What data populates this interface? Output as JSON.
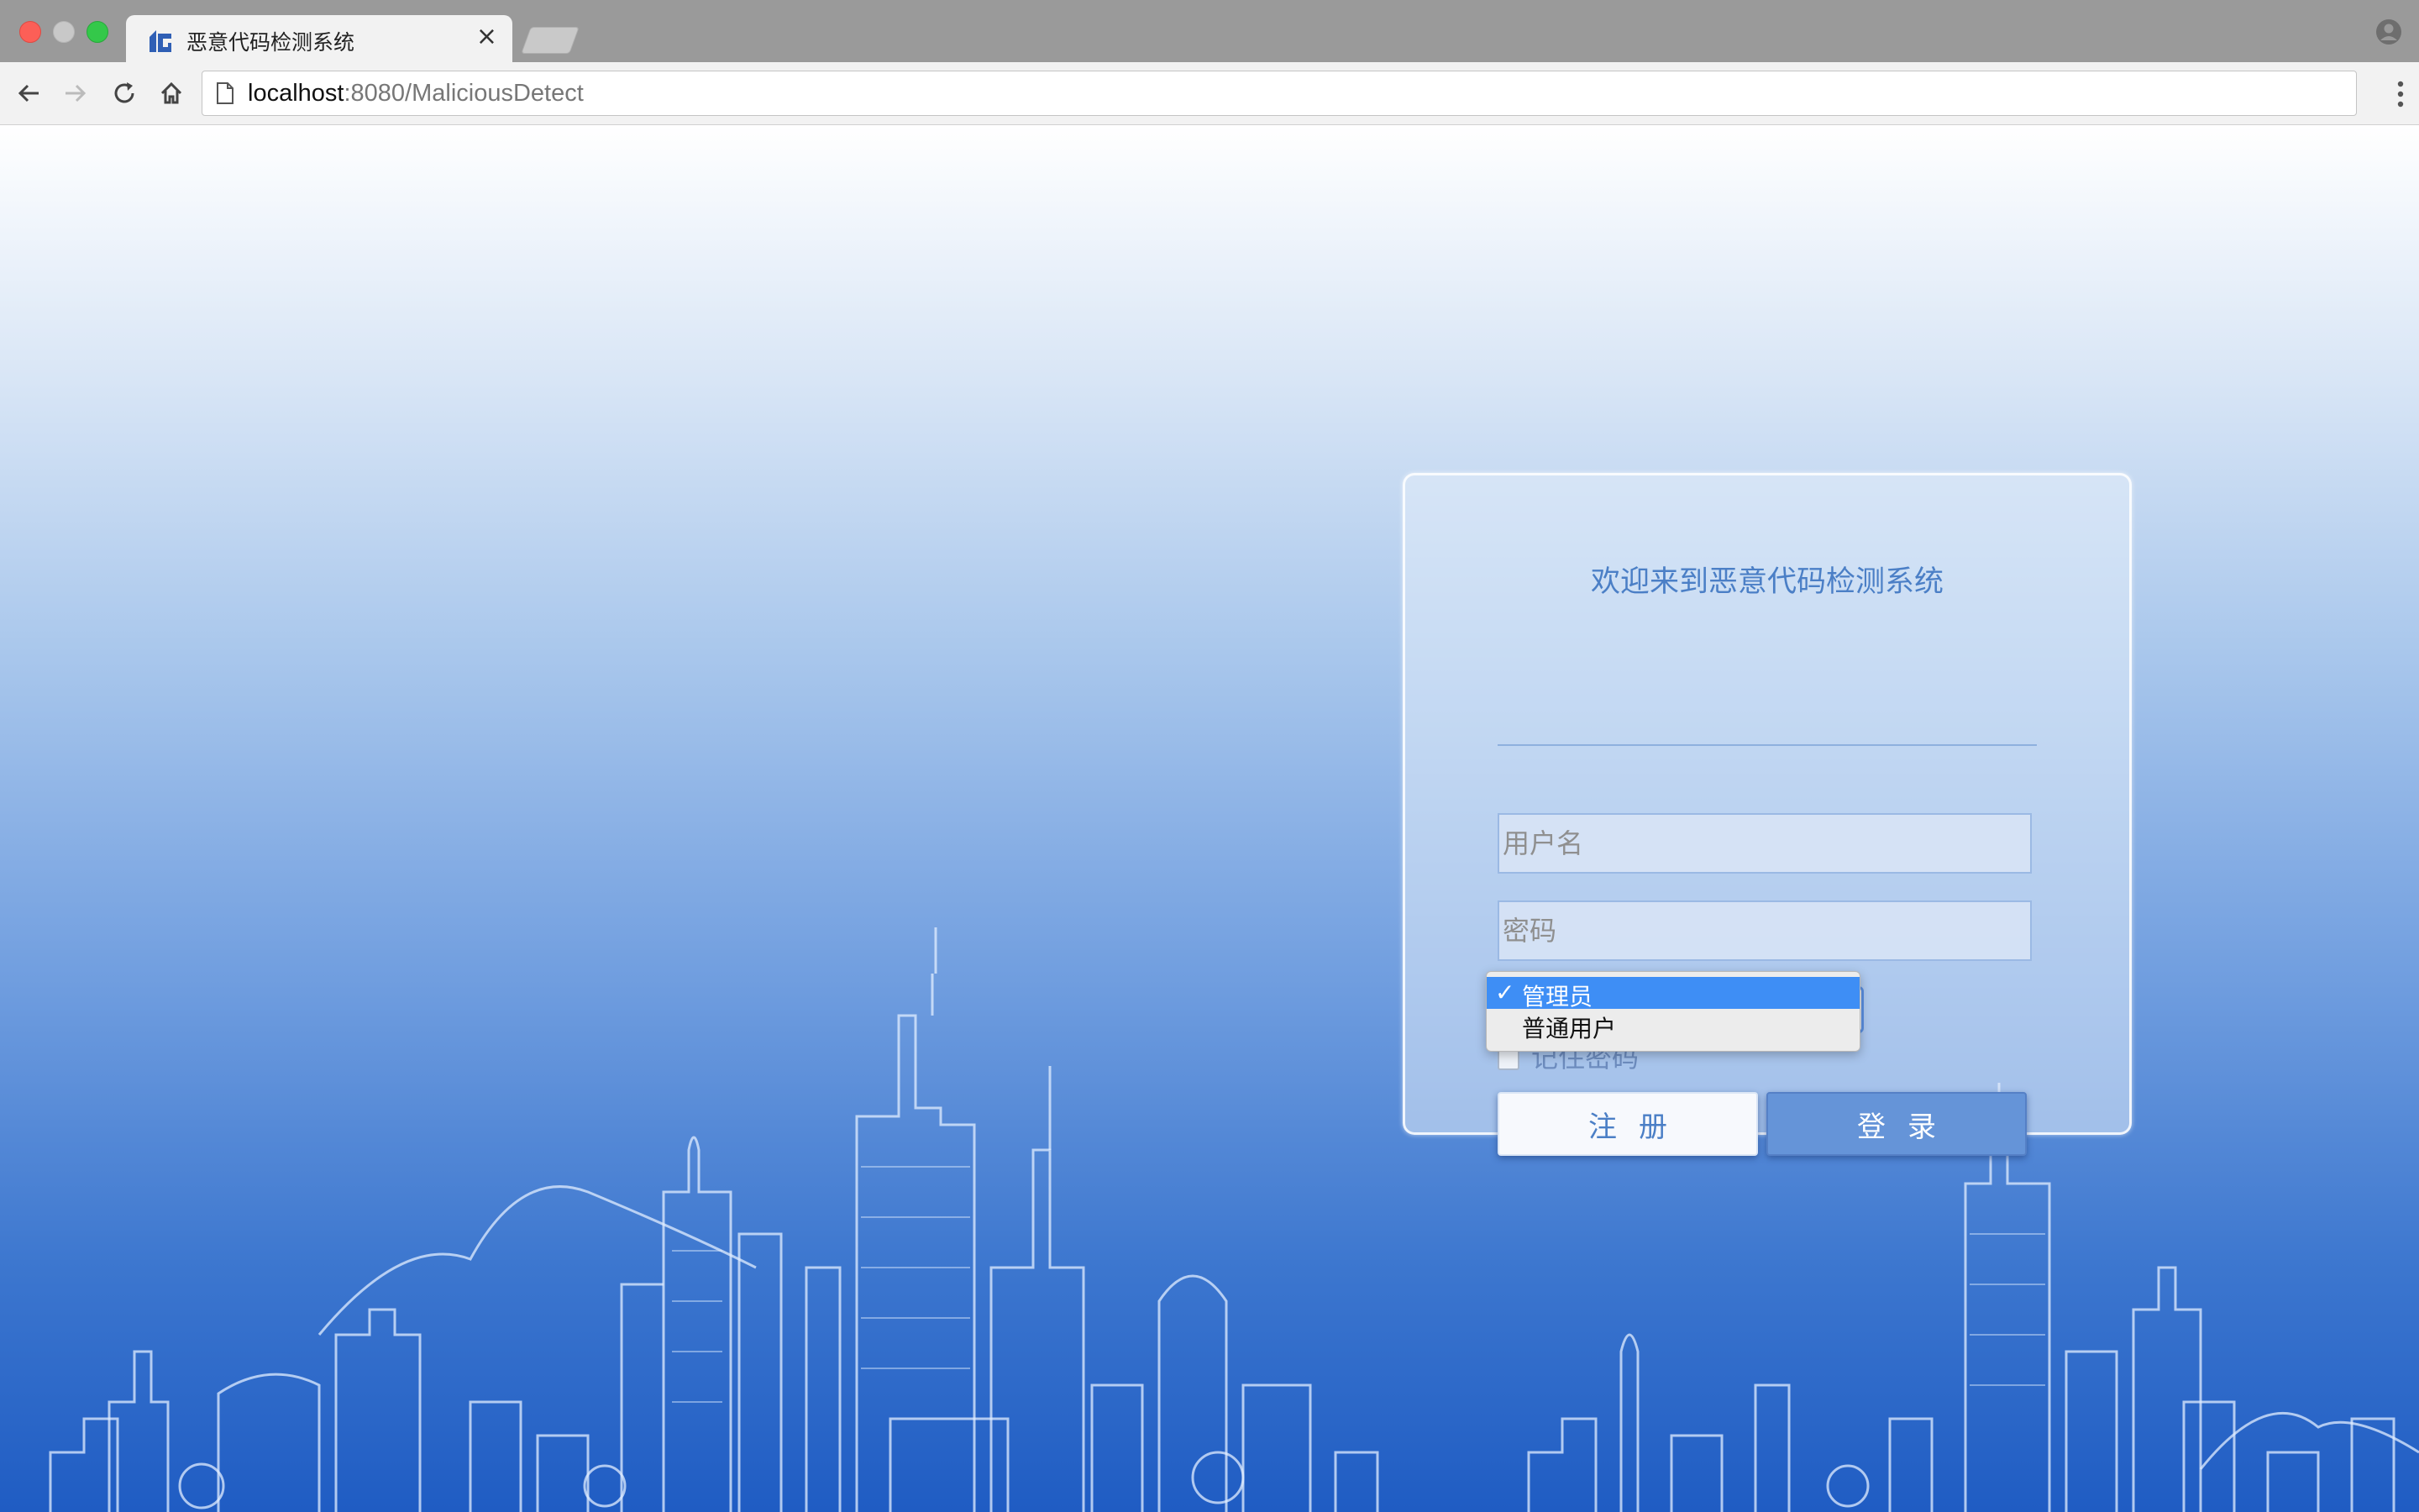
{
  "browser": {
    "tab_title": "恶意代码检测系统",
    "tab_close": "×",
    "url_host": "localhost",
    "url_rest": ":8080/MaliciousDetect"
  },
  "login": {
    "title": "欢迎来到恶意代码检测系统",
    "username_placeholder": "用户名",
    "password_placeholder": "密码",
    "role_options": [
      "管理员",
      "普通用户"
    ],
    "role_selected": "管理员",
    "remember_label": "记住密码",
    "register_label": "注册",
    "login_label": "登录"
  },
  "colors": {
    "title": "#4b7fc6",
    "primary_button": "#6594d8",
    "dropdown_highlight": "#3e8ef5"
  }
}
